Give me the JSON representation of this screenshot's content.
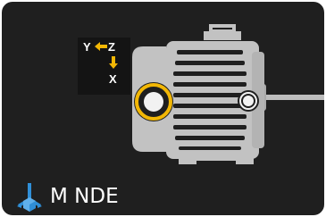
{
  "axis_indicator": {
    "y_label": "Y",
    "z_label": "Z",
    "x_label": "X"
  },
  "sensor_location": {
    "label": "M NDE",
    "icon": "axes-cube-icon"
  },
  "motor": {
    "icon": "electric-motor-icon",
    "selected_point": "nde-measurement-point",
    "other_point": "de-measurement-point"
  },
  "colors": {
    "background": "#1f1f1f",
    "motor_body": "#c2c2c2",
    "highlight_ring": "#f2b705",
    "axis_arrow": "#f2b705",
    "icon_blue": "#2f8fd8"
  }
}
